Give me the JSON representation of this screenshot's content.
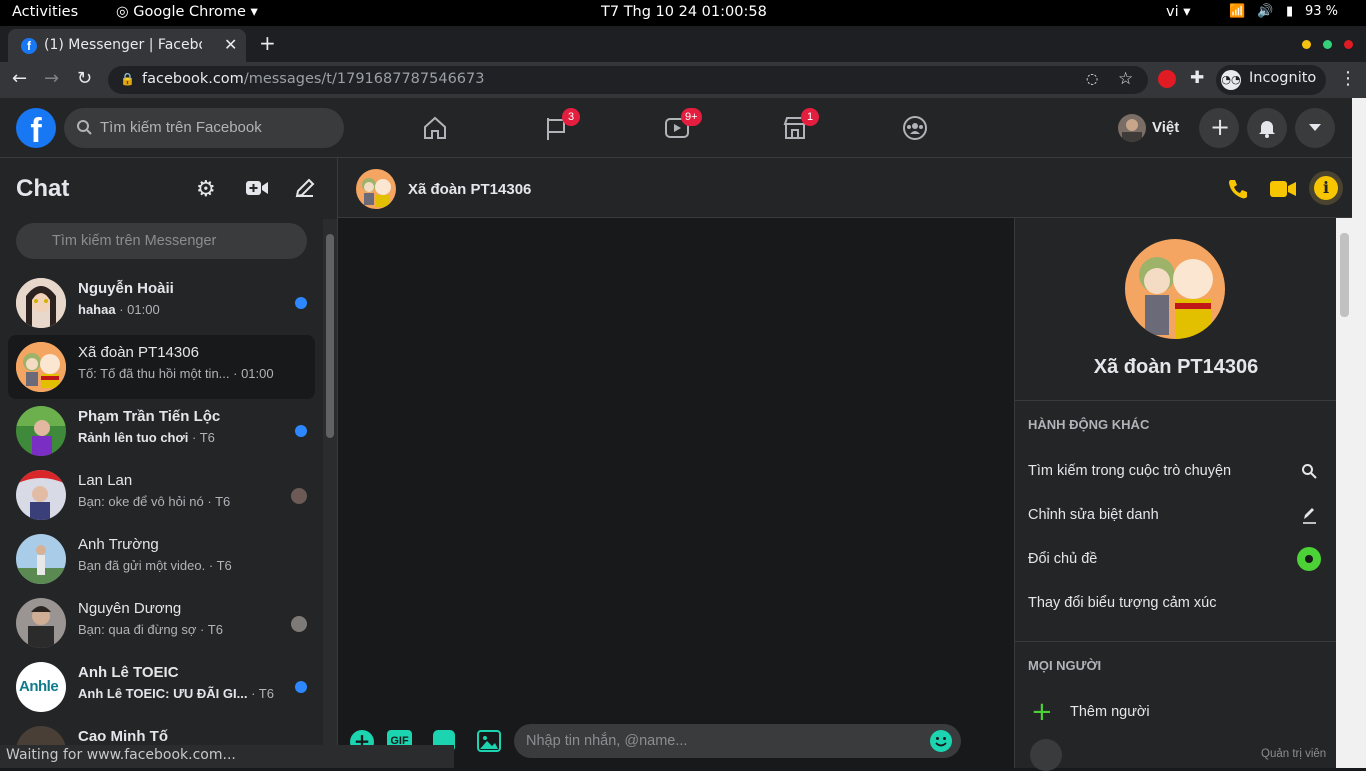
{
  "os": {
    "activities": "Activities",
    "app": "Google Chrome",
    "datetime": "T7 Thg 10 24  01:00:58",
    "lang": "vi",
    "battery": "93 %"
  },
  "browser": {
    "tab_title": "(1) Messenger | Facebo",
    "url_host": "facebook.com",
    "url_path": "/messages/t/1791687787546673",
    "incognito": "Incognito"
  },
  "fb": {
    "search_placeholder": "Tìm kiếm trên Facebook",
    "badges": {
      "pages": "3",
      "watch": "9+",
      "marketplace": "1"
    },
    "user": "Việt"
  },
  "chat": {
    "title": "Chat",
    "search_placeholder": "Tìm kiếm trên Messenger",
    "conversations": [
      {
        "name": "Nguyễn Hoàii",
        "preview": "hahaa",
        "time": "01:00",
        "unread": true
      },
      {
        "name": "Xã đoàn PT14306",
        "preview": "Tố: Tố đã thu hồi một tin...",
        "time": "01:00",
        "selected": true
      },
      {
        "name": "Phạm Trần Tiến Lộc",
        "preview": "Rảnh lên tuo chơi",
        "time": "T6",
        "unread": true
      },
      {
        "name": "Lan Lan",
        "preview": "Bạn: oke để vô hỏi nó",
        "time": "T6"
      },
      {
        "name": "Anh Trường",
        "preview": "Bạn đã gửi một video.",
        "time": "T6"
      },
      {
        "name": "Nguyên Dương",
        "preview": "Bạn: qua đi đừng sợ",
        "time": "T6"
      },
      {
        "name": "Anh Lê TOEIC",
        "preview": "Anh Lê TOEIC: ƯU ĐÃI GI...",
        "time": "T6",
        "unread": true
      },
      {
        "name": "Cao Minh Tố",
        "preview": "",
        "time": ""
      }
    ]
  },
  "conversation": {
    "title": "Xã đoàn PT14306",
    "composer_placeholder": "Nhập tin nhắn, @name...",
    "gif": "GIF"
  },
  "info": {
    "name": "Xã đoàn PT14306",
    "section_actions": "HÀNH ĐỘNG KHÁC",
    "actions": [
      "Tìm kiếm trong cuộc trò chuyện",
      "Chỉnh sửa biệt danh",
      "Đổi chủ đề",
      "Thay đổi biểu tượng cảm xúc"
    ],
    "section_people": "MỌI NGƯỜI",
    "add_people": "Thêm người",
    "admin": "Quản trị viên"
  },
  "status_bar": "Waiting for www.facebook.com...",
  "colors": {
    "accent": "#f7c600",
    "badge": "#e41e3f",
    "unread_dot": "#2d88ff",
    "theme": "#4cd137",
    "fb_blue": "#1877f2"
  }
}
